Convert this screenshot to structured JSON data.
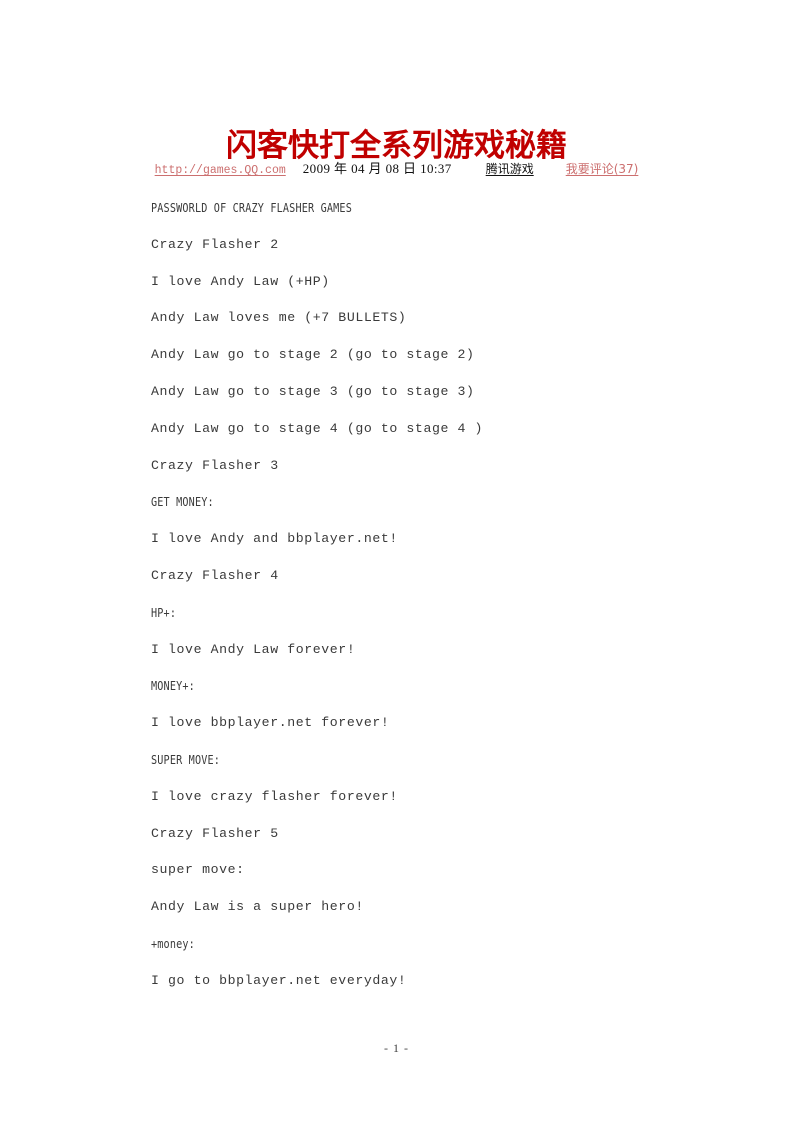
{
  "document": {
    "title": "闪客快打全系列游戏秘籍",
    "title_color": "#c00000",
    "footer": "- 1 -"
  },
  "meta": {
    "url": "http://games.QQ.com",
    "url_color": "#cc6f6f",
    "date": "2009 年 04 月 08 日 10:37",
    "source": "腾讯游戏",
    "comment_link": "我要评论(37)",
    "comment_link_color": "#cc6f6f"
  },
  "body": {
    "lines": [
      {
        "text": "PASSWORLD OF CRAZY FLASHER GAMES",
        "style": "narrow"
      },
      {
        "text": "Crazy Flasher 2",
        "style": "normal"
      },
      {
        "text": "I love Andy Law (+HP)",
        "style": "normal"
      },
      {
        "text": "Andy Law loves me (+7 BULLETS)",
        "style": "normal"
      },
      {
        "text": "Andy Law go to stage 2 (go to stage 2)",
        "style": "normal"
      },
      {
        "text": "Andy Law go to stage 3 (go to stage 3)",
        "style": "normal"
      },
      {
        "text": "Andy Law go to stage 4 (go to stage 4 )",
        "style": "normal"
      },
      {
        "text": "Crazy Flasher 3",
        "style": "normal"
      },
      {
        "text": "GET MONEY:",
        "style": "narrow"
      },
      {
        "text": "I love Andy and bbplayer.net!",
        "style": "normal"
      },
      {
        "text": "Crazy Flasher 4",
        "style": "normal"
      },
      {
        "text": "HP+:",
        "style": "narrow"
      },
      {
        "text": "I love Andy Law forever!",
        "style": "normal"
      },
      {
        "text": "MONEY+:",
        "style": "narrow"
      },
      {
        "text": "I love bbplayer.net forever!",
        "style": "normal"
      },
      {
        "text": "SUPER MOVE:",
        "style": "narrow"
      },
      {
        "text": "I love crazy flasher forever!",
        "style": "normal"
      },
      {
        "text": "Crazy Flasher 5",
        "style": "normal"
      },
      {
        "text": "super move:",
        "style": "normal"
      },
      {
        "text": "Andy Law is a super hero!",
        "style": "normal"
      },
      {
        "text": "+money:",
        "style": "narrow"
      },
      {
        "text": "I go to bbplayer.net everyday!",
        "style": "normal"
      }
    ]
  }
}
